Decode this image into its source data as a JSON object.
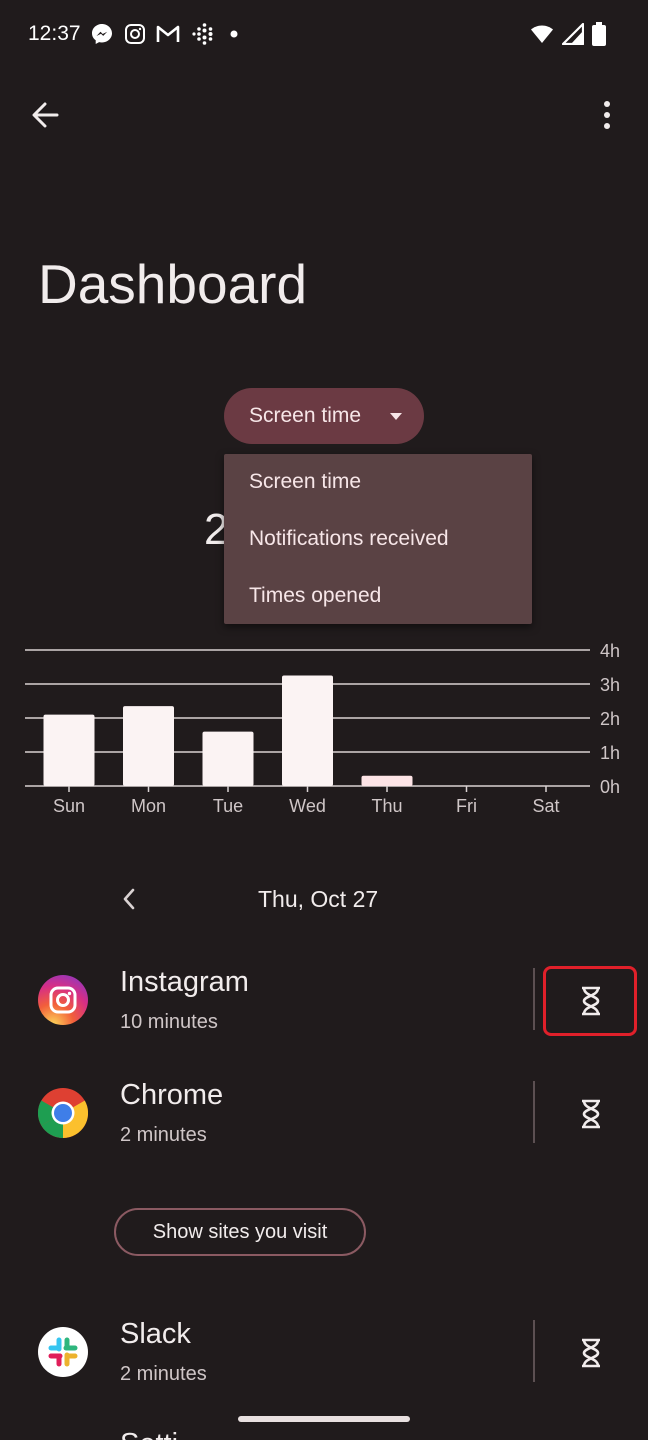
{
  "status_bar": {
    "time": "12:37",
    "notification_icons": [
      "messenger-icon",
      "instagram-icon",
      "gmail-icon",
      "fitbit-icon",
      "dot-icon"
    ],
    "system_icons": [
      "wifi-icon",
      "signal-icon",
      "battery-icon"
    ]
  },
  "page": {
    "title": "Dashboard"
  },
  "metric_selector": {
    "selected": "Screen time",
    "options": [
      "Screen time",
      "Notifications received",
      "Times opened"
    ]
  },
  "summary": {
    "partial_value": "2"
  },
  "chart_data": {
    "type": "bar",
    "categories": [
      "Sun",
      "Mon",
      "Tue",
      "Wed",
      "Thu",
      "Fri",
      "Sat"
    ],
    "values": [
      2.1,
      2.35,
      1.6,
      3.25,
      0.3,
      0,
      0
    ],
    "y_ticks": [
      "4h",
      "3h",
      "2h",
      "1h",
      "0h"
    ],
    "ylim": [
      0,
      4
    ],
    "highlighted_category": "Thu",
    "colors": {
      "bar": "#fbf3f3",
      "selected_bar": "#fde4e6",
      "grid": "#d9d2d2"
    }
  },
  "date_nav": {
    "label": "Thu, Oct 27"
  },
  "apps": [
    {
      "name": "Instagram",
      "usage": "10 minutes",
      "icon": "instagram-icon"
    },
    {
      "name": "Chrome",
      "usage": "2 minutes",
      "icon": "chrome-icon"
    },
    {
      "name": "Slack",
      "usage": "2 minutes",
      "icon": "slack-icon"
    }
  ],
  "show_sites_label": "Show sites you visit",
  "partial_next_app": "Setti"
}
